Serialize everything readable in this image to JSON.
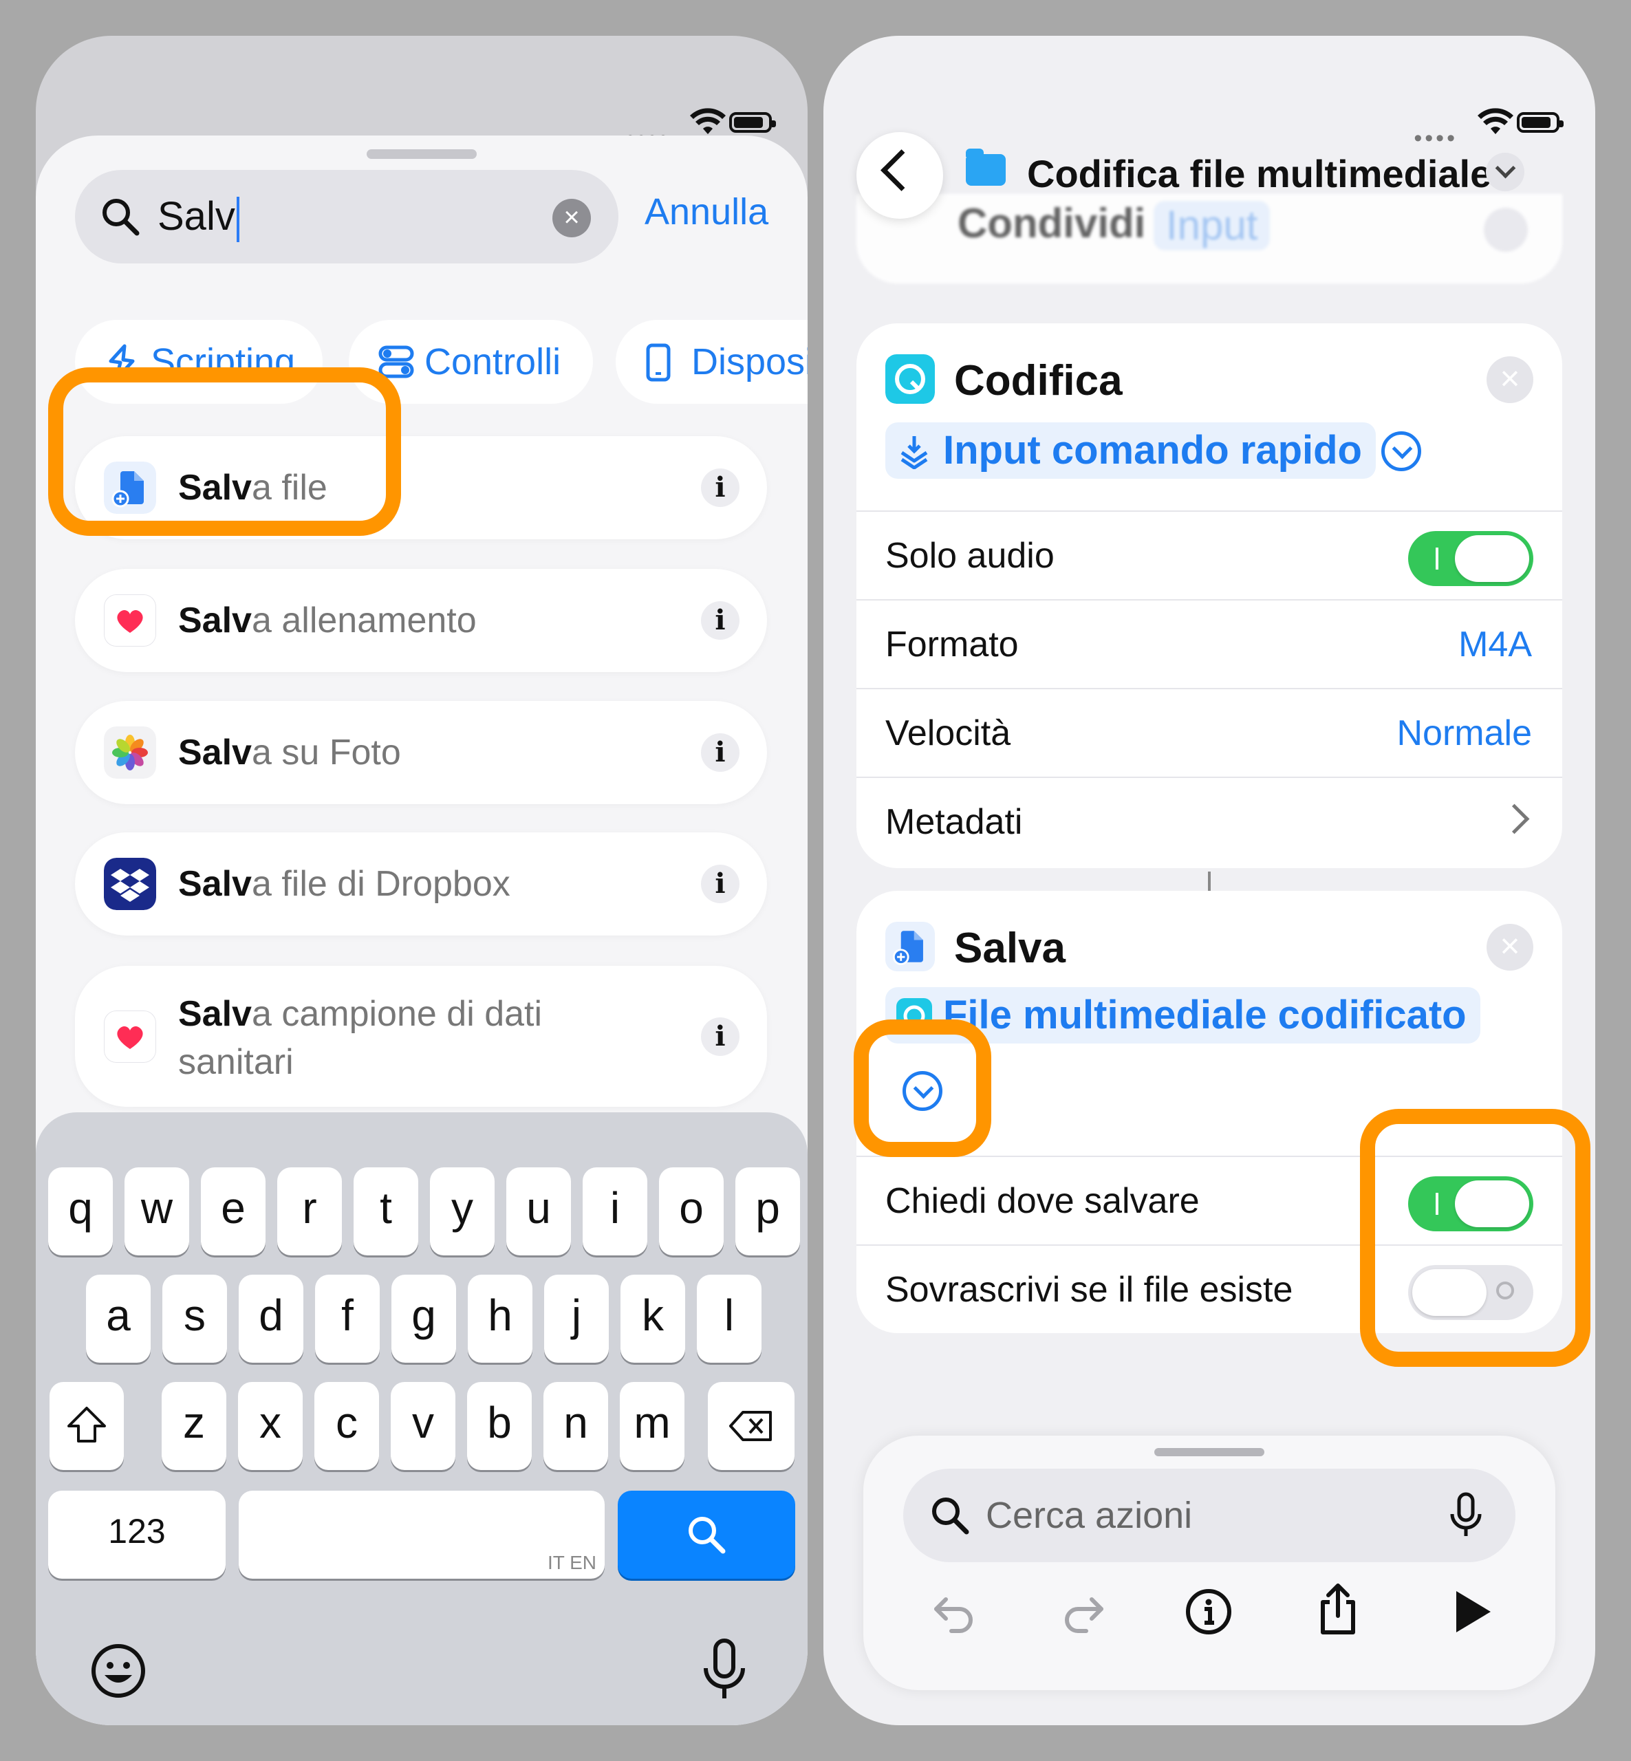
{
  "left": {
    "search": {
      "query": "Salv",
      "clear_label": "×",
      "cancel_label": "Annulla"
    },
    "chips": [
      {
        "label": "Scripting",
        "icon": "scripting-icon"
      },
      {
        "label": "Controlli",
        "icon": "controls-icon"
      },
      {
        "label": "Disposi",
        "icon": "device-icon"
      }
    ],
    "results": [
      {
        "match": "Salv",
        "rest": "a file",
        "icon": "save-file-icon"
      },
      {
        "match": "Salv",
        "rest": "a allenamento",
        "icon": "health-heart-icon"
      },
      {
        "match": "Salv",
        "rest": "a su Foto",
        "icon": "photos-icon"
      },
      {
        "match": "Salv",
        "rest": "a file di Dropbox",
        "icon": "dropbox-icon"
      },
      {
        "match": "Salv",
        "rest": "a campione di dati sanitari",
        "icon": "health-heart-icon"
      }
    ],
    "info_label": "i",
    "keyboard": {
      "row1": [
        "q",
        "w",
        "e",
        "r",
        "t",
        "y",
        "u",
        "i",
        "o",
        "p"
      ],
      "row2": [
        "a",
        "s",
        "d",
        "f",
        "g",
        "h",
        "j",
        "k",
        "l"
      ],
      "row3": [
        "z",
        "x",
        "c",
        "v",
        "b",
        "n",
        "m"
      ],
      "numbers_label": "123",
      "space_hint": "IT EN"
    }
  },
  "right": {
    "title": "Codifica file multimediale",
    "ghost": {
      "label": "Condividi",
      "chip": "Input"
    },
    "encode_card": {
      "title": "Codifica",
      "input_pill": "Input comando rapido",
      "rows": [
        {
          "label": "Solo audio",
          "type": "toggle",
          "on": true
        },
        {
          "label": "Formato",
          "value": "M4A"
        },
        {
          "label": "Velocità",
          "value": "Normale"
        },
        {
          "label": "Metadati",
          "type": "chevron"
        }
      ]
    },
    "save_card": {
      "title": "Salva",
      "input_pill": "File multimediale codificato",
      "rows": [
        {
          "label": "Chiedi dove salvare",
          "on": true
        },
        {
          "label": "Sovrascrivi se il file esiste",
          "on": false
        }
      ]
    },
    "bottom": {
      "search_placeholder": "Cerca azioni",
      "toolbar": [
        "undo-icon",
        "redo-icon",
        "info-icon",
        "share-icon",
        "play-icon"
      ]
    }
  },
  "colors": {
    "accent": "#1e7cf0",
    "highlight": "#ff9500",
    "toggle_on": "#34c759"
  }
}
